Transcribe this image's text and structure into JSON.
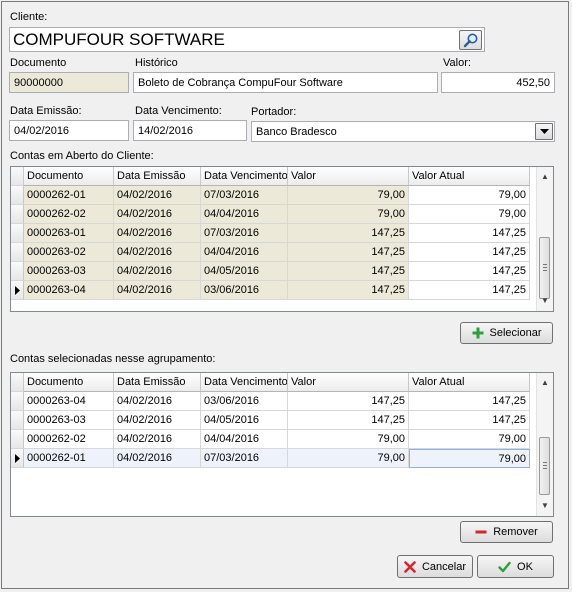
{
  "cliente": {
    "label": "Cliente:",
    "value": "COMPUFOUR SOFTWARE"
  },
  "documento": {
    "label": "Documento",
    "value": "90000000"
  },
  "historico": {
    "label": "Histórico",
    "value": "Boleto de Cobrança CompuFour Software"
  },
  "valor": {
    "label": "Valor:",
    "value": "452,50"
  },
  "data_emissao": {
    "label": "Data Emissão:",
    "value": "04/02/2016"
  },
  "data_vencimento": {
    "label": "Data Vencimento:",
    "value": "14/02/2016"
  },
  "portador": {
    "label": "Portador:",
    "value": "Banco Bradesco"
  },
  "open_accounts": {
    "label": "Contas em Aberto do Cliente:",
    "columns": [
      "Documento",
      "Data Emissão",
      "Data Vencimento",
      "Valor",
      "Valor Atual"
    ],
    "rows": [
      {
        "doc": "0000262-01",
        "emissao": "04/02/2016",
        "venc": "07/03/2016",
        "valor": "79,00",
        "atual": "79,00"
      },
      {
        "doc": "0000262-02",
        "emissao": "04/02/2016",
        "venc": "04/04/2016",
        "valor": "79,00",
        "atual": "79,00"
      },
      {
        "doc": "0000263-01",
        "emissao": "04/02/2016",
        "venc": "07/03/2016",
        "valor": "147,25",
        "atual": "147,25"
      },
      {
        "doc": "0000263-02",
        "emissao": "04/02/2016",
        "venc": "04/04/2016",
        "valor": "147,25",
        "atual": "147,25"
      },
      {
        "doc": "0000263-03",
        "emissao": "04/02/2016",
        "venc": "04/05/2016",
        "valor": "147,25",
        "atual": "147,25"
      },
      {
        "doc": "0000263-04",
        "emissao": "04/02/2016",
        "venc": "03/06/2016",
        "valor": "147,25",
        "atual": "147,25"
      }
    ],
    "current_row_index": 5
  },
  "select_button": {
    "label": "Selecionar",
    "icon": "plus-icon",
    "icon_color": "#2e9e3e"
  },
  "selected_accounts": {
    "label": "Contas selecionadas nesse agrupamento:",
    "columns": [
      "Documento",
      "Data Emissão",
      "Data Vencimento",
      "Valor",
      "Valor Atual"
    ],
    "rows": [
      {
        "doc": "0000263-04",
        "emissao": "04/02/2016",
        "venc": "03/06/2016",
        "valor": "147,25",
        "atual": "147,25"
      },
      {
        "doc": "0000263-03",
        "emissao": "04/02/2016",
        "venc": "04/05/2016",
        "valor": "147,25",
        "atual": "147,25"
      },
      {
        "doc": "0000262-02",
        "emissao": "04/02/2016",
        "venc": "04/04/2016",
        "valor": "79,00",
        "atual": "79,00"
      },
      {
        "doc": "0000262-01",
        "emissao": "04/02/2016",
        "venc": "07/03/2016",
        "valor": "79,00",
        "atual": "79,00"
      }
    ],
    "current_row_index": 3
  },
  "remove_button": {
    "label": "Remover",
    "icon": "minus-icon",
    "icon_color": "#d0282e"
  },
  "cancel_button": {
    "label": "Cancelar",
    "icon": "x-icon",
    "icon_color": "#d0282e"
  },
  "ok_button": {
    "label": "OK",
    "icon": "checkmark-icon",
    "icon_color": "#2e9e3e"
  },
  "colors": {
    "readonly_field": "#ece9d8",
    "selected_row": "#eef3fb",
    "border": "#828790"
  }
}
